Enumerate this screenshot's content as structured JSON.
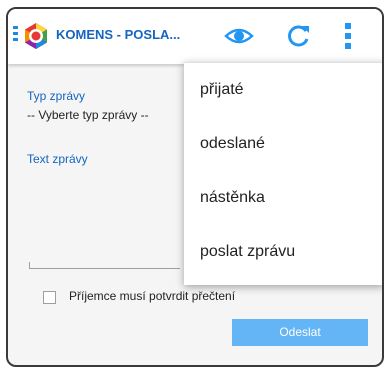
{
  "header": {
    "title": "KOMENS - POSLA...",
    "icons": [
      "menu-icon",
      "app-logo",
      "eye-icon",
      "refresh-icon",
      "more-vert-icon"
    ],
    "accent": "#1565c0"
  },
  "form": {
    "type_label": "Typ zprávy",
    "type_select_value": "-- Vyberte typ zprávy --",
    "text_label": "Text zprávy",
    "confirm_label": "Příjemce musí potvrdit přečtení",
    "send_label": "Odeslat"
  },
  "menu": {
    "items": [
      {
        "label": "přijaté"
      },
      {
        "label": "odeslané"
      },
      {
        "label": "nástěnka"
      },
      {
        "label": "poslat zprávu"
      }
    ]
  }
}
